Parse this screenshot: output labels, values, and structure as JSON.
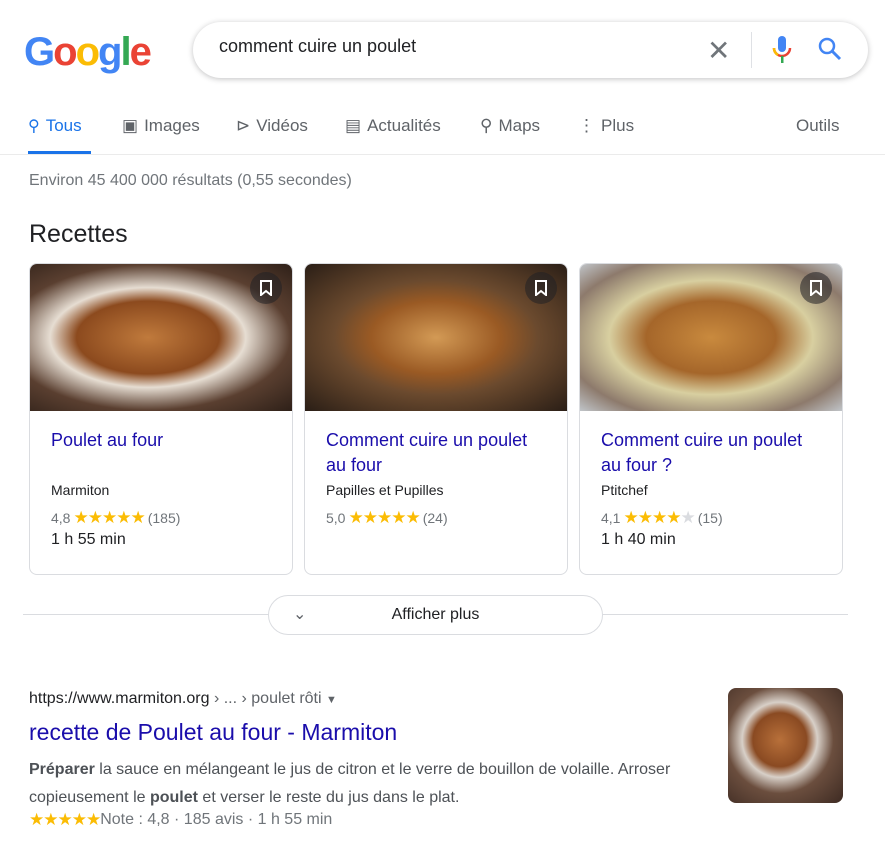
{
  "search": {
    "query": "comment cuire un poulet",
    "logo": "Google"
  },
  "tabs": [
    {
      "label": "Tous",
      "icon": "search-icon",
      "active": true
    },
    {
      "label": "Images",
      "icon": "image-icon"
    },
    {
      "label": "Vidéos",
      "icon": "play-icon"
    },
    {
      "label": "Actualités",
      "icon": "news-icon"
    },
    {
      "label": "Maps",
      "icon": "map-pin-icon"
    },
    {
      "label": "Plus",
      "icon": "more-vert-icon"
    }
  ],
  "tools_label": "Outils",
  "stats": "Environ 45 400 000 résultats (0,55 secondes)",
  "recipes": {
    "heading": "Recettes",
    "cards": [
      {
        "title": "Poulet au four",
        "source": "Marmiton",
        "rating": "4,8",
        "stars": 5,
        "reviews": "(185)",
        "time": "1 h 55 min"
      },
      {
        "title": "Comment cuire un poulet au four",
        "source": "Papilles et Pupilles",
        "rating": "5,0",
        "stars": 5,
        "reviews": "(24)",
        "time": ""
      },
      {
        "title": "Comment cuire un poulet au four ?",
        "source": "Ptitchef",
        "rating": "4,1",
        "stars": 4,
        "reviews": "(15)",
        "time": "1 h 40 min"
      }
    ],
    "more_label": "Afficher plus"
  },
  "result": {
    "url": "https://www.marmiton.org",
    "crumb": " › ... › poulet rôti",
    "title": "recette de Poulet au four - Marmiton",
    "snippet": {
      "b1": "Préparer",
      "t1": " la sauce en mélangeant le jus de citron et le verre de bouillon de volaille. Arroser copieusement le ",
      "b2": "poulet",
      "t2": " et verser le reste du jus dans le plat."
    },
    "meta": "Note : 4,8 · 185 avis · 1 h 55 min",
    "stars": 5
  },
  "colors": {
    "accent": "#1a73e8",
    "link": "#1a0dab",
    "star": "#fbbc04"
  }
}
